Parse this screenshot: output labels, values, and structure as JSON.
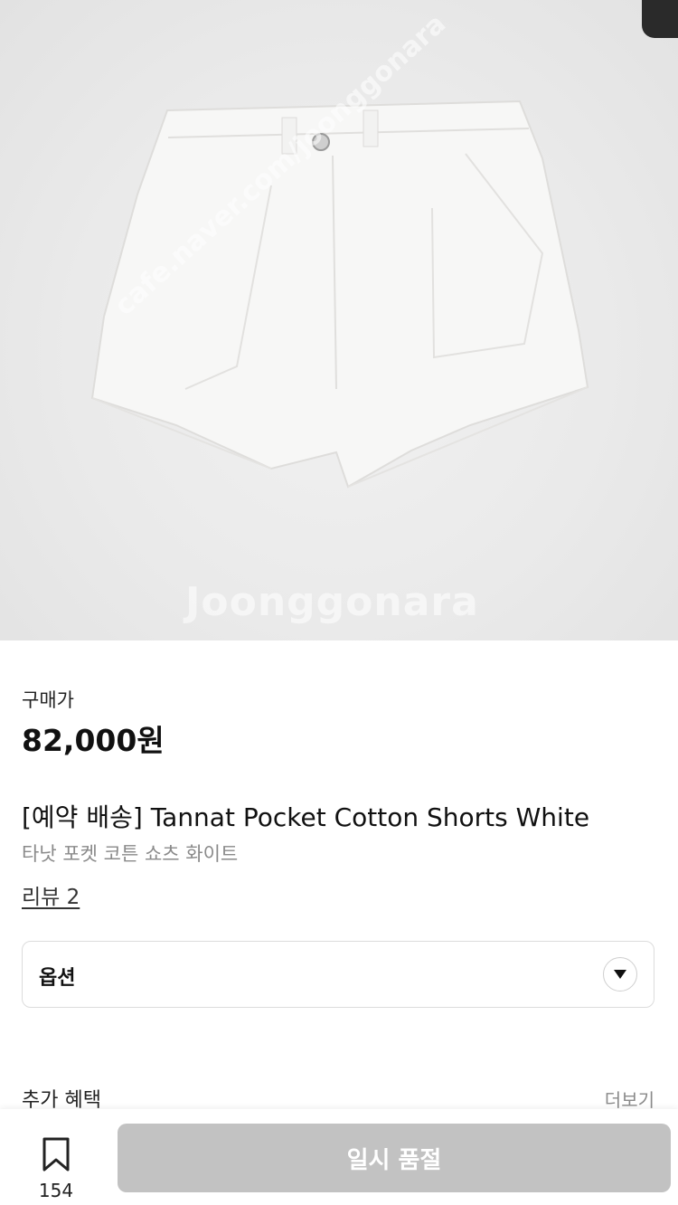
{
  "product": {
    "price_label": "구매가",
    "price": "82,000원",
    "title": "[예약 배송] Tannat Pocket Cotton Shorts White",
    "subtitle": "타낫 포켓 코튼 쇼츠 화이트",
    "review_link": "리뷰 2"
  },
  "watermark": {
    "main": "Joonggonara",
    "diagonal": "cafe.naver.com/joonggonara"
  },
  "option_select": {
    "label": "옵션",
    "icon": "chevron-down-icon"
  },
  "benefits": {
    "title": "추가 혜택",
    "more": "더보기"
  },
  "bottom_bar": {
    "bookmark_count": "154",
    "bookmark_icon": "bookmark-icon",
    "action_label": "일시 품절"
  },
  "colors": {
    "disabled_button": "#c2c2c2",
    "muted_text": "#8a8a8a"
  }
}
